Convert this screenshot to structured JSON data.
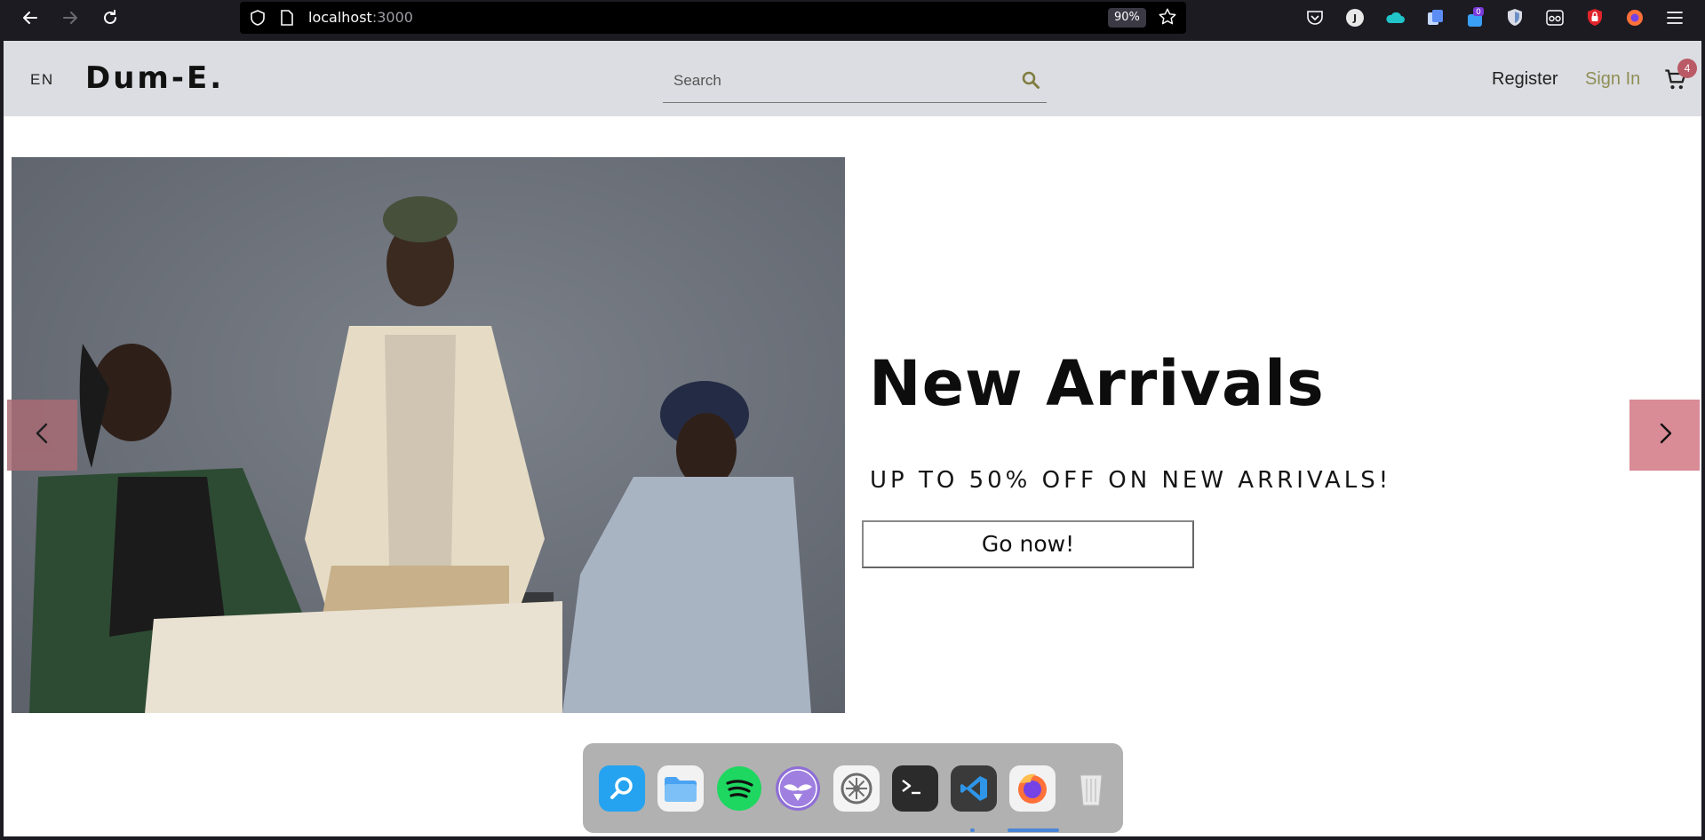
{
  "browser": {
    "url_host": "localhost",
    "url_port": ":3000",
    "zoom": "90%",
    "extension_badge": "0"
  },
  "header": {
    "language": "EN",
    "logo": "Dum-E.",
    "search_placeholder": "Search",
    "register_label": "Register",
    "signin_label": "Sign In",
    "cart_count": "4"
  },
  "hero": {
    "title": "New Arrivals",
    "subtitle": "UP TO 50% OFF ON NEW ARRIVALS!",
    "button_label": "Go now!"
  },
  "dock": {
    "items": [
      "search-app",
      "files",
      "spotify",
      "beard-app",
      "settings",
      "terminal",
      "vscode",
      "firefox",
      "trash"
    ]
  },
  "colors": {
    "header_bg": "#dcdde2",
    "accent_signin": "#8e8e55",
    "arrow_bg": "#d98b96",
    "cart_badge": "#b95a66"
  }
}
